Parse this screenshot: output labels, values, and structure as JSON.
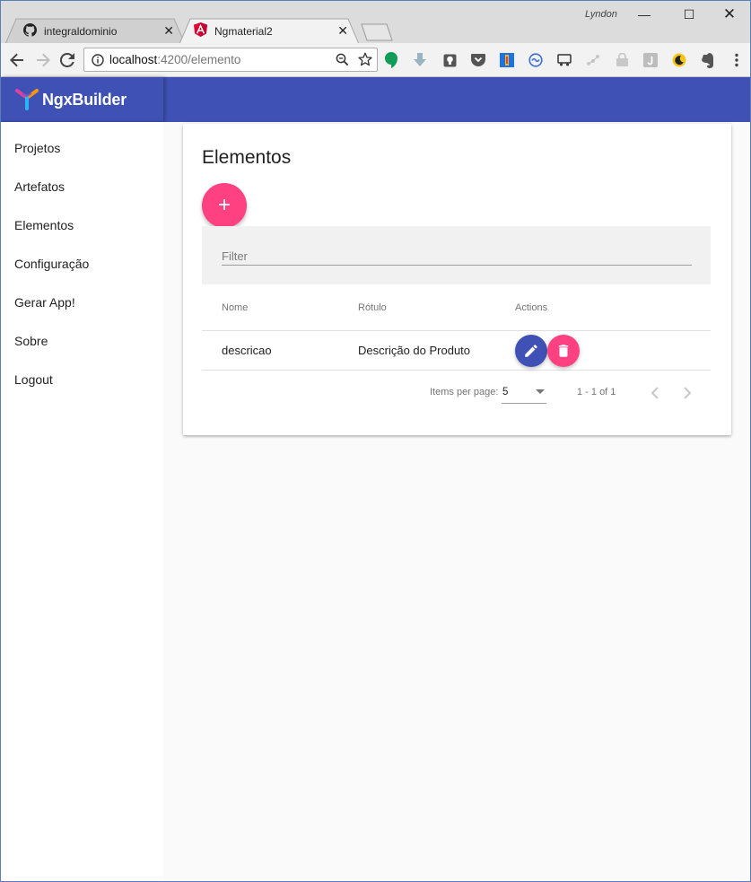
{
  "browser": {
    "user": "Lyndon",
    "tabs": [
      {
        "title": "integraldominio",
        "icon": "github-icon",
        "active": false
      },
      {
        "title": "Ngmaterial2",
        "icon": "angular-icon",
        "active": true
      }
    ],
    "url_host": "localhost",
    "url_path": ":4200/elemento"
  },
  "app": {
    "brand": "NgxBuilder",
    "nav": [
      "Projetos",
      "Artefatos",
      "Elementos",
      "Configuração",
      "Gerar App!",
      "Sobre",
      "Logout"
    ]
  },
  "card": {
    "title": "Elementos",
    "add_label": "+",
    "filter_placeholder": "Filter",
    "columns": [
      "Nome",
      "Rótulo",
      "Actions"
    ],
    "rows": [
      {
        "nome": "descricao",
        "rotulo": "Descrição do Produto"
      }
    ],
    "paginator": {
      "items_label": "Items per page:",
      "page_size": "5",
      "range": "1 - 1 of 1"
    }
  },
  "colors": {
    "primary": "#3f51b5",
    "accent": "#ff4081"
  }
}
